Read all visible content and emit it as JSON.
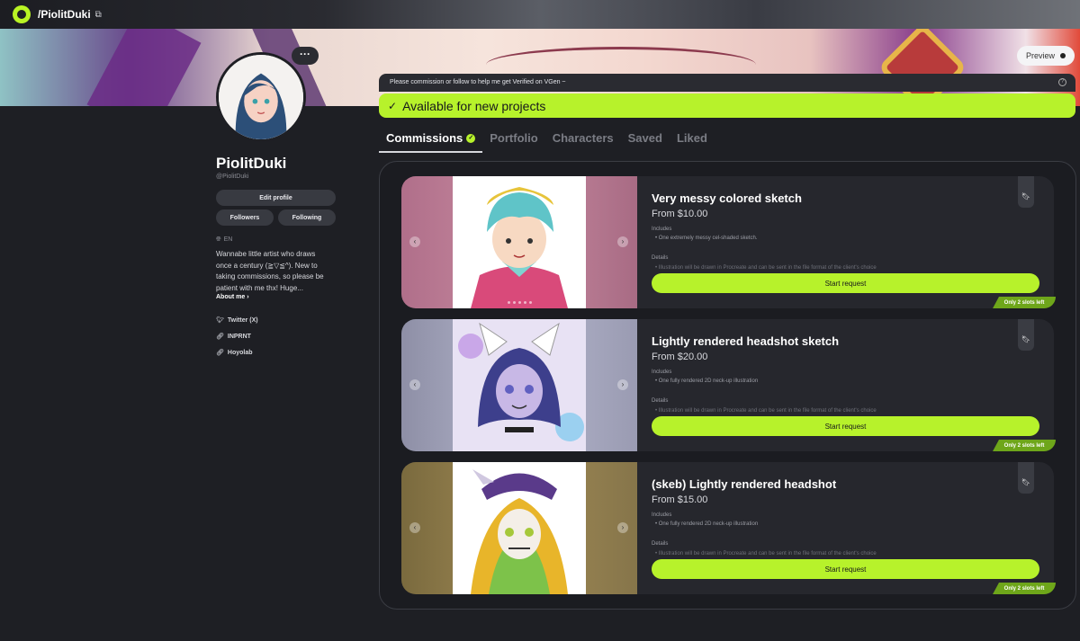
{
  "nav": {
    "handle": "/PiolitDuki",
    "logo_icon": "vgen-logo-icon",
    "copy_icon": "copy-icon"
  },
  "banner": {
    "preview_label": "Preview"
  },
  "profile": {
    "more_label": "···",
    "display_name": "PiolitDuki",
    "handle": "@PiolitDuki",
    "edit_label": "Edit profile",
    "followers_label": "Followers",
    "following_label": "Following",
    "language": "EN",
    "bio": "Wannabe little artist who draws once a century (≧▽≦^). New to taking commissions, so please be patient with me thx! Huge...",
    "about_label": "About me ›",
    "links": [
      {
        "icon": "twitter-icon",
        "label": "Twitter (X)"
      },
      {
        "icon": "link-icon",
        "label": "INPRNT"
      },
      {
        "icon": "link-icon",
        "label": "Hoyolab"
      }
    ]
  },
  "notice": {
    "text": "Please commission or follow to help me get Verified on VGen ~",
    "availability": "Available for new projects"
  },
  "tabs": [
    "Commissions",
    "Portfolio",
    "Characters",
    "Saved",
    "Liked"
  ],
  "commissions": [
    {
      "title": "Very messy colored sketch",
      "price": "From $10.00",
      "includes_label": "Includes",
      "include_item": "• One extremely messy cel-shaded sketch.",
      "details_label": "Details",
      "detail_item": "• Illustration will be drawn in Procreate and can be sent in the file format of the client's choice",
      "cta": "Start request",
      "slots": "Only 2 slots left"
    },
    {
      "title": "Lightly rendered headshot sketch",
      "price": "From $20.00",
      "includes_label": "Includes",
      "include_item": "• One fully rendered 2D neck-up illustration",
      "details_label": "Details",
      "detail_item": "• Illustration will be drawn in Procreate and can be sent in the file format of the client's choice",
      "cta": "Start request",
      "slots": "Only 2 slots left"
    },
    {
      "title": "(skeb) Lightly rendered headshot",
      "price": "From $15.00",
      "includes_label": "Includes",
      "include_item": "• One fully rendered 2D neck-up illustration",
      "details_label": "Details",
      "detail_item": "• Illustration will be drawn in Procreate and can be sent in the file format of the client's choice",
      "cta": "Start request",
      "slots": "Only 2 slots left"
    }
  ],
  "colors": {
    "accent": "#b7f22b",
    "background": "#1e1f24",
    "card": "#26272d"
  }
}
